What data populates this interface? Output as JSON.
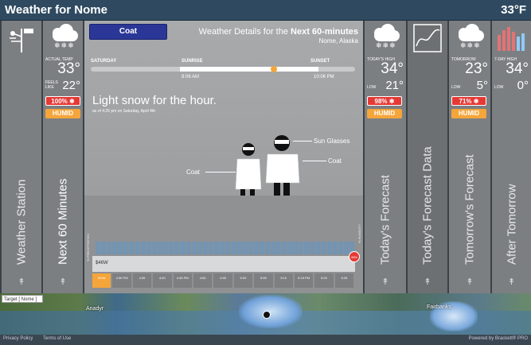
{
  "title": "Weather for Nome",
  "current_temp": "33°F",
  "weather_station": {
    "label": "Weather Station"
  },
  "next60": {
    "actual_temp_label": "ACTUAL TEMP",
    "temp": "33°",
    "feels_like_label": "FEELS LIKE",
    "feels_like": "22°",
    "precip": "100% ❄",
    "humid": "HUMID",
    "label": "Next 60 Minutes"
  },
  "main": {
    "coat_button": "Coat",
    "details_prefix": "Weather Details for the ",
    "details_bold": "Next 60-minutes",
    "location": "Nome, Alaska",
    "day_label": "SATURDAY",
    "sunrise_label": "SUNRISE",
    "sunset_label": "SUNSET",
    "sunrise_time": "8:06 AM",
    "sunset_time": "10:06 PM",
    "headline": "Light snow for the hour.",
    "as_of": "as of 4:26 pm on Saturday, April 4th",
    "figure_labels": {
      "sunglasses": "Sun Glasses",
      "coat_right": "Coat",
      "coat_left": "Coat"
    },
    "precip_axis": "% PRECIPITATION",
    "precip_axis_right": "% HUMIDITY",
    "low_bar": "$46W",
    "red_badge": "98%",
    "ticks": [
      "NOW",
      "4:30 PM",
      "4:35",
      "4:40",
      "4:45 PM",
      "4:50",
      "4:55",
      "5:00",
      "5:05",
      "5:10",
      "5:15 PM",
      "5:20",
      "5:25"
    ]
  },
  "today": {
    "high_label": "TODAY'S HIGH",
    "high": "34°",
    "low_label": "LOW",
    "low": "21°",
    "precip": "98% ❄",
    "humid": "HUMID",
    "label": "Today's Forecast"
  },
  "forecast_data": {
    "label": "Today's Forecast Data"
  },
  "tomorrow": {
    "label_top": "TOMORROW",
    "high": "23°",
    "low_label": "LOW",
    "low": "5°",
    "precip": "71% ❄",
    "humid": "HUMID",
    "label": "Tomorrow's Forecast"
  },
  "after_tomorrow": {
    "high_label": "7-DAY HIGH",
    "high": "34°",
    "low_label": "LOW",
    "low": "0°",
    "label": "After Tomorrow"
  },
  "map": {
    "target": "Target [ Nome ]",
    "city1": "Anadyr",
    "city2": "Fairbanks"
  },
  "footer": {
    "privacy": "Privacy Policy",
    "terms": "Terms of Use",
    "powered": "Powered by Brackett® PRO"
  },
  "colors": {
    "accent_red": "#e53935",
    "accent_orange": "#f5a53a",
    "button_blue": "#2b3796"
  }
}
